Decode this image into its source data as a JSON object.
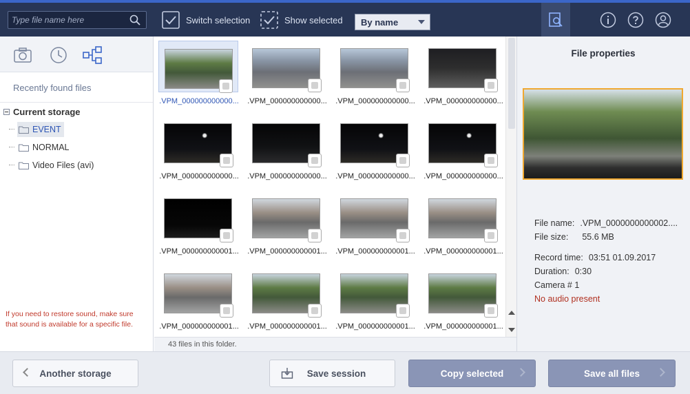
{
  "toolbar": {
    "search_placeholder": "Type file name here",
    "switch_selection": "Switch selection",
    "show_selected": "Show selected",
    "sort_value": "By name"
  },
  "left": {
    "recent": "Recently found files",
    "root": "Current storage",
    "folders": [
      "EVENT",
      "NORMAL",
      "Video Files (avi)"
    ],
    "note": "If you need to restore sound, make sure that sound is available for a specific file."
  },
  "grid": {
    "files": [
      ".VPM_000000000000...",
      ".VPM_000000000000...",
      ".VPM_000000000000...",
      ".VPM_000000000000...",
      ".VPM_000000000000...",
      ".VPM_000000000000...",
      ".VPM_000000000000...",
      ".VPM_000000000000...",
      ".VPM_000000000001...",
      ".VPM_000000000001...",
      ".VPM_000000000001...",
      ".VPM_000000000001...",
      ".VPM_000000000001...",
      ".VPM_000000000001...",
      ".VPM_000000000001...",
      ".VPM_000000000001..."
    ],
    "status": "43 files in this folder."
  },
  "props": {
    "title": "File properties",
    "name_label": "File name:",
    "name_value": ".VPM_0000000000002....",
    "size_label": "File size:",
    "size_value": "55.6 MB",
    "record_label": "Record time:",
    "record_value": "03:51 01.09.2017",
    "duration_label": "Duration:",
    "duration_value": "0:30",
    "camera": "Camera # 1",
    "audio": "No audio present"
  },
  "buttons": {
    "another_storage": "Another storage",
    "save_session": "Save session",
    "copy_selected": "Copy selected",
    "save_all": "Save all files"
  },
  "colors": {
    "toolbar_bg": "#283655",
    "accent": "#3b66c8",
    "selected_text": "#2f56b5",
    "preview_border": "#f0a830",
    "warning": "#b03020"
  }
}
